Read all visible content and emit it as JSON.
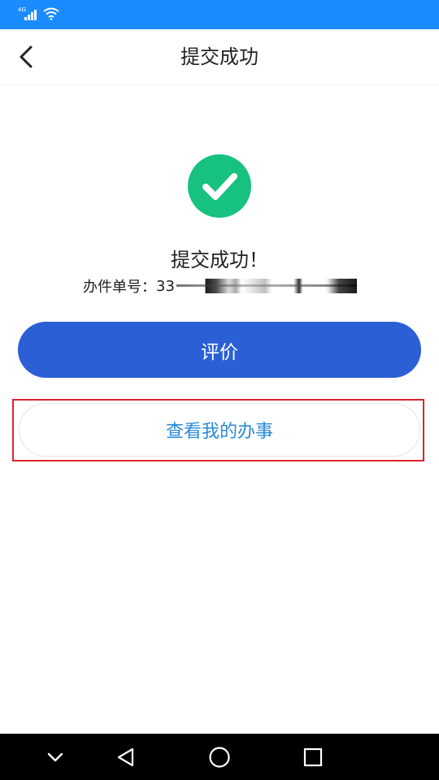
{
  "status_bar": {
    "network_label": "4G",
    "background_color": "#1a8cff",
    "icons": [
      "signal-icon",
      "wifi-icon"
    ]
  },
  "header": {
    "title": "提交成功",
    "back_icon": "chevron-left-icon"
  },
  "result": {
    "icon": "check-circle-icon",
    "icon_color": "#17c17f",
    "title": "提交成功！",
    "ticket_label": "办件单号：",
    "ticket_visible_prefix": "33"
  },
  "actions": {
    "evaluate_label": "评价",
    "evaluate_color": "#2b5fd6",
    "view_label": "查看我的办事",
    "view_text_color": "#2a8ad8",
    "highlight_color": "#d8262e"
  },
  "nav_bar": {
    "icons": [
      "chevron-down-icon",
      "back-triangle-icon",
      "home-circle-icon",
      "recents-square-icon"
    ]
  }
}
